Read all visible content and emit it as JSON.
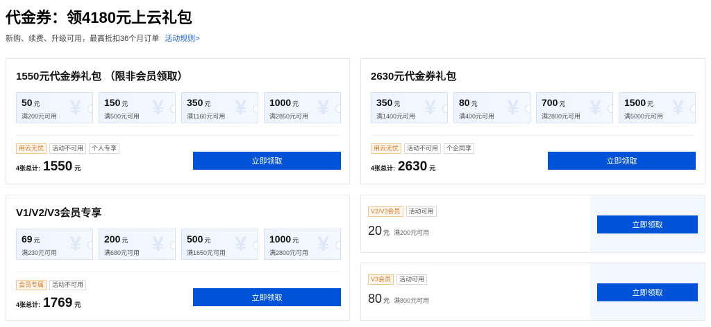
{
  "header": {
    "title": "代金券：领4180元上云礼包",
    "subtitle": "新购、续费、升级可用，最高抵扣36个月订单",
    "rules_link": "活动规则>"
  },
  "packages": [
    {
      "title": "1550元代金券礼包 （限非会员领取）",
      "coupons": [
        {
          "amount": "50",
          "unit": "元",
          "condition": "满200元可用"
        },
        {
          "amount": "150",
          "unit": "元",
          "condition": "满500元可用"
        },
        {
          "amount": "350",
          "unit": "元",
          "condition": "满1160元可用"
        },
        {
          "amount": "1000",
          "unit": "元",
          "condition": "满2850元可用"
        }
      ],
      "tags": [
        {
          "text": "用云无忧",
          "style": "orange"
        },
        {
          "text": "活动不可用",
          "style": "gray"
        },
        {
          "text": "个人专享",
          "style": "gray"
        }
      ],
      "total_label": "4张总计:",
      "total_value": "1550",
      "total_unit": "元",
      "button": "立即领取"
    },
    {
      "title": "2630元代金券礼包",
      "coupons": [
        {
          "amount": "350",
          "unit": "元",
          "condition": "满1400元可用"
        },
        {
          "amount": "80",
          "unit": "元",
          "condition": "满400元可用"
        },
        {
          "amount": "700",
          "unit": "元",
          "condition": "满2800元可用"
        },
        {
          "amount": "1500",
          "unit": "元",
          "condition": "满5000元可用"
        }
      ],
      "tags": [
        {
          "text": "用云无忧",
          "style": "orange"
        },
        {
          "text": "活动不可用",
          "style": "gray"
        },
        {
          "text": "个企同享",
          "style": "gray"
        }
      ],
      "total_label": "4张总计:",
      "total_value": "2630",
      "total_unit": "元",
      "button": "立即领取"
    },
    {
      "title": "V1/V2/V3会员专享",
      "coupons": [
        {
          "amount": "69",
          "unit": "元",
          "condition": "满230元可用"
        },
        {
          "amount": "200",
          "unit": "元",
          "condition": "满680元可用"
        },
        {
          "amount": "500",
          "unit": "元",
          "condition": "满1650元可用"
        },
        {
          "amount": "1000",
          "unit": "元",
          "condition": "满2800元可用"
        }
      ],
      "tags": [
        {
          "text": "会员专属",
          "style": "orange"
        },
        {
          "text": "活动不可用",
          "style": "gray"
        }
      ],
      "total_label": "4张总计:",
      "total_value": "1769",
      "total_unit": "元",
      "button": "立即领取"
    }
  ],
  "single_coupons": [
    {
      "tags": [
        {
          "text": "V2/V3会员",
          "style": "orange"
        },
        {
          "text": "活动可用",
          "style": "gray"
        }
      ],
      "amount": "20",
      "unit": "元",
      "condition": "满200元可用",
      "button": "立即领取"
    },
    {
      "tags": [
        {
          "text": "V3会员",
          "style": "orange"
        },
        {
          "text": "活动可用",
          "style": "gray"
        }
      ],
      "amount": "80",
      "unit": "元",
      "condition": "满800元可用",
      "button": "立即领取"
    }
  ],
  "colors": {
    "primary_button": "#0052d9",
    "link": "#1a5fd6",
    "tag_orange": "#d9782a",
    "coupon_bg": "#eef4ff"
  },
  "icons": {
    "coupon_watermark": "yen-icon",
    "coupon_watermark_glyph": "¥"
  }
}
